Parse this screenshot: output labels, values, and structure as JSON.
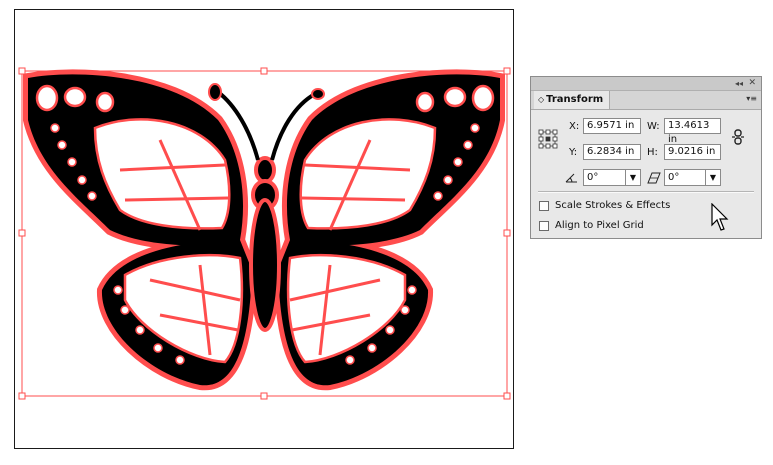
{
  "panel": {
    "tab_title": "Transform",
    "tab_arrows": "◇",
    "close_glyph": "✕",
    "collapse_glyph": "◂◂",
    "menu_glyph": "▾≡",
    "x_label": "X:",
    "x_value": "6.9571 in",
    "y_label": "Y:",
    "y_value": "6.2834 in",
    "w_label": "W:",
    "w_value": "13.4613 in",
    "h_label": "H:",
    "h_value": "9.0216 in",
    "rotate_value": "0°",
    "shear_value": "0°",
    "scale_strokes_label": "Scale Strokes & Effects",
    "scale_strokes_checked": false,
    "align_pixel_label": "Align to Pixel Grid",
    "align_pixel_checked": false,
    "dropdown_arrow": "▼"
  },
  "colors": {
    "selection": "#ff4d4d",
    "art_fill": "#000000"
  }
}
